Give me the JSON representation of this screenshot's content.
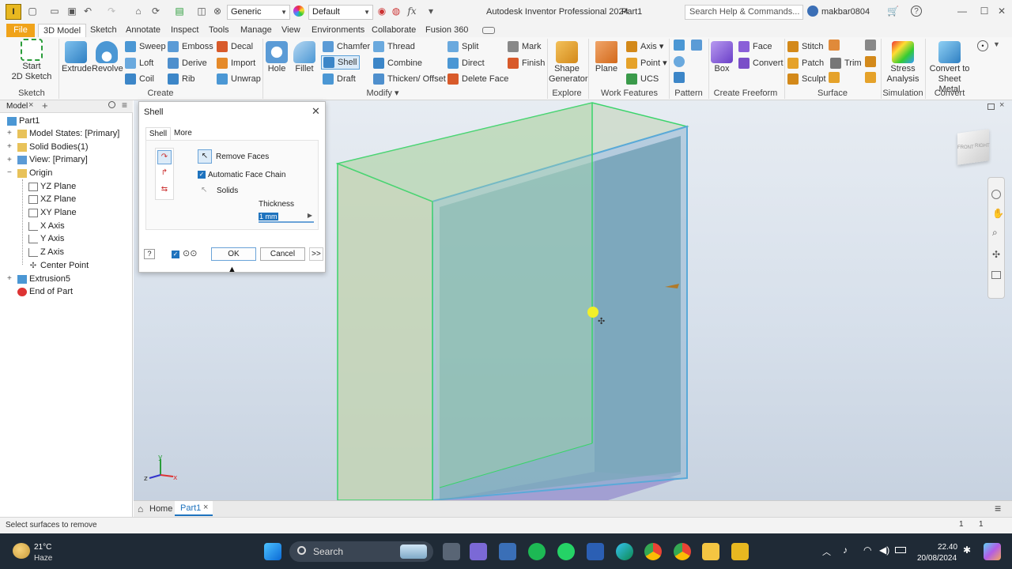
{
  "titlebar": {
    "logo_letter": "I",
    "visual_style": "Generic",
    "appearance": "Default",
    "app_title": "Autodesk Inventor Professional 2024",
    "document": "Part1",
    "search_placeholder": "Search Help & Commands...",
    "user": "makbar0804"
  },
  "tabs": [
    "File",
    "3D Model",
    "Sketch",
    "Annotate",
    "Inspect",
    "Tools",
    "Manage",
    "View",
    "Environments",
    "Collaborate",
    "Fusion 360"
  ],
  "ribbon": {
    "sketch": {
      "start_line1": "Start",
      "start_line2": "2D Sketch",
      "group": "Sketch"
    },
    "create": {
      "extrude": "Extrude",
      "revolve": "Revolve",
      "sweep": "Sweep",
      "loft": "Loft",
      "coil": "Coil",
      "emboss": "Emboss",
      "derive": "Derive",
      "rib": "Rib",
      "decal": "Decal",
      "import": "Import",
      "unwrap": "Unwrap",
      "group": "Create"
    },
    "modify": {
      "hole": "Hole",
      "fillet": "Fillet",
      "chamfer": "Chamfer",
      "shell": "Shell",
      "draft": "Draft",
      "thread": "Thread",
      "combine": "Combine",
      "thicken": "Thicken/ Offset",
      "split": "Split",
      "direct": "Direct",
      "delete_face": "Delete Face",
      "group": "Modify"
    },
    "mark": {
      "mark": "Mark",
      "finish": "Finish"
    },
    "explore": {
      "shape_line1": "Shape",
      "shape_line2": "Generator",
      "group": "Explore"
    },
    "work": {
      "plane": "Plane",
      "axis": "Axis",
      "point": "Point",
      "ucs": "UCS",
      "group": "Work Features"
    },
    "pattern": {
      "group": "Pattern"
    },
    "freeform": {
      "box": "Box",
      "face": "Face",
      "convert": "Convert",
      "group": "Create Freeform"
    },
    "surface": {
      "stitch": "Stitch",
      "patch": "Patch",
      "sculpt": "Sculpt",
      "trim": "Trim",
      "group": "Surface"
    },
    "simulation": {
      "line1": "Stress",
      "line2": "Analysis",
      "group": "Simulation"
    },
    "convert": {
      "line1": "Convert to",
      "line2": "Sheet Metal",
      "group": "Convert"
    }
  },
  "browser": {
    "tab": "Model",
    "items": [
      {
        "label": "Part1"
      },
      {
        "label": "Model States: [Primary]"
      },
      {
        "label": "Solid Bodies(1)"
      },
      {
        "label": "View: [Primary]"
      },
      {
        "label": "Origin"
      },
      {
        "label": "YZ Plane"
      },
      {
        "label": "XZ Plane"
      },
      {
        "label": "XY Plane"
      },
      {
        "label": "X Axis"
      },
      {
        "label": "Y Axis"
      },
      {
        "label": "Z Axis"
      },
      {
        "label": "Center Point"
      },
      {
        "label": "Extrusion5"
      },
      {
        "label": "End of Part"
      }
    ]
  },
  "dialog": {
    "title": "Shell",
    "tab_shell": "Shell",
    "tab_more": "More",
    "remove_faces": "Remove Faces",
    "auto_face_chain": "Automatic Face Chain",
    "solids": "Solids",
    "thickness_label": "Thickness",
    "thickness_value": "1 mm",
    "ok": "OK",
    "cancel": "Cancel",
    "expand": ">>"
  },
  "viewcube": {
    "front": "FRONT",
    "right": "RIGHT"
  },
  "triad": {
    "x": "x",
    "y": "y",
    "z": "z"
  },
  "doctabs": {
    "home": "Home",
    "part": "Part1"
  },
  "status": {
    "message": "Select surfaces to remove",
    "count1": "1",
    "count2": "1"
  },
  "taskbar": {
    "temp": "21°C",
    "weather": "Haze",
    "search": "Search",
    "time": "22.40",
    "date": "20/08/2024"
  },
  "colors": {
    "accent": "#1e73be",
    "file_tab": "#f0a31a",
    "green_edge": "#39d46a",
    "blue_edge": "#5aa9d8"
  }
}
